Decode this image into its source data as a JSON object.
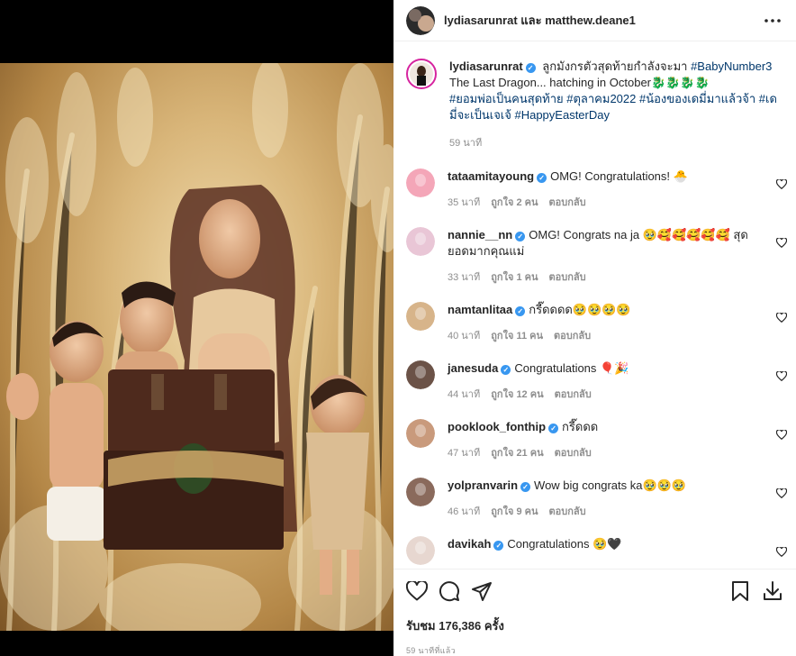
{
  "header": {
    "title": "lydiasarunrat และ matthew.deane1",
    "avatar_icon": "avatar-icon",
    "more_icon": "more-horizontal-icon"
  },
  "caption": {
    "username": "lydiasarunrat",
    "text_main": "ลูกมังกรตัวสุดท้ายกำลังจะมา",
    "hashtag_1": "#BabyNumber3",
    "text_line2": "The Last Dragon... hatching in October🐉🐉🐉🐉",
    "hashtags_rest": "#ยอมพ่อเป็นคนสุดท้าย #ตุลาคม2022 #น้องของเดมี่มาแล้วจ้า #เดมี่จะเป็นเจเจ้ #HappyEasterDay",
    "time": "59 นาที"
  },
  "comments": [
    {
      "username": "tataamitayoung",
      "text": "OMG! Congratulations! 🐣",
      "time": "35 นาที",
      "likes": "ถูกใจ 2 คน",
      "reply": "ตอบกลับ",
      "avatar_color": "#f4a6b8"
    },
    {
      "username": "nannie__nn",
      "text": "OMG! Congrats na ja 🥹🥰🥰🥰🥰🥰 สุดยอดมากคุณแม่",
      "time": "33 นาที",
      "likes": "ถูกใจ 1 คน",
      "reply": "ตอบกลับ",
      "avatar_color": "#e9c6d6"
    },
    {
      "username": "namtanlitaa",
      "text": "กรี๊ดดดด🥹🥹🥹🥹",
      "time": "40 นาที",
      "likes": "ถูกใจ 11 คน",
      "reply": "ตอบกลับ",
      "avatar_color": "#d7b48a"
    },
    {
      "username": "janesuda",
      "text": "Congratulations 🎈🎉",
      "time": "44 นาที",
      "likes": "ถูกใจ 12 คน",
      "reply": "ตอบกลับ",
      "avatar_color": "#6b5247"
    },
    {
      "username": "pooklook_fonthip",
      "text": "กรี๊ดดด",
      "time": "47 นาที",
      "likes": "ถูกใจ 21 คน",
      "reply": "ตอบกลับ",
      "avatar_color": "#c99a7c"
    },
    {
      "username": "yolpranvarin",
      "text": "Wow big congrats ka🥹🥹🥹",
      "time": "46 นาที",
      "likes": "ถูกใจ 9 คน",
      "reply": "ตอบกลับ",
      "avatar_color": "#8a6a5c"
    },
    {
      "username": "davikah",
      "text": "Congratulations 🥹🖤",
      "time": "",
      "likes": "",
      "reply": "",
      "avatar_color": "#e7d7d0"
    }
  ],
  "footer": {
    "views": "รับชม 176,386 ครั้ง",
    "posted": "59 นาทีที่แล้ว",
    "icons": [
      "heart-icon",
      "comment-icon",
      "share-icon",
      "bookmark-icon",
      "download-icon"
    ]
  },
  "colors": {
    "link": "#00376b",
    "muted": "#8e8e8e",
    "verified": "#3897f0",
    "border": "#efefef"
  }
}
